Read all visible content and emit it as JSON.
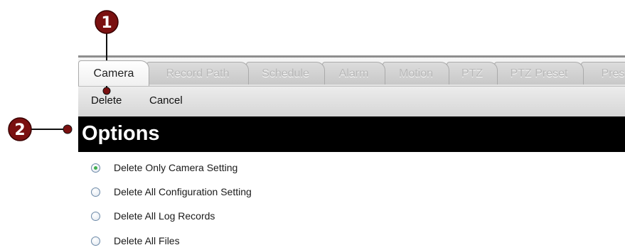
{
  "callouts": [
    {
      "number": "1"
    },
    {
      "number": "2"
    }
  ],
  "tabs": [
    {
      "label": "Camera",
      "active": true
    },
    {
      "label": "Record Path",
      "active": false
    },
    {
      "label": "Schedule",
      "active": false
    },
    {
      "label": "Alarm",
      "active": false
    },
    {
      "label": "Motion",
      "active": false
    },
    {
      "label": "PTZ",
      "active": false
    },
    {
      "label": "PTZ Preset",
      "active": false
    },
    {
      "label": "Pres",
      "active": false
    }
  ],
  "toolbar": {
    "delete_label": "Delete",
    "cancel_label": "Cancel"
  },
  "options": {
    "title": "Options",
    "items": [
      {
        "label": "Delete Only Camera Setting",
        "selected": true
      },
      {
        "label": "Delete All Configuration Setting",
        "selected": false
      },
      {
        "label": "Delete All Log Records",
        "selected": false
      },
      {
        "label": "Delete All Files",
        "selected": false
      }
    ]
  },
  "colors": {
    "callout": "#7a1010",
    "header_bg": "#000000",
    "radio_selected": "#3fae4f"
  }
}
